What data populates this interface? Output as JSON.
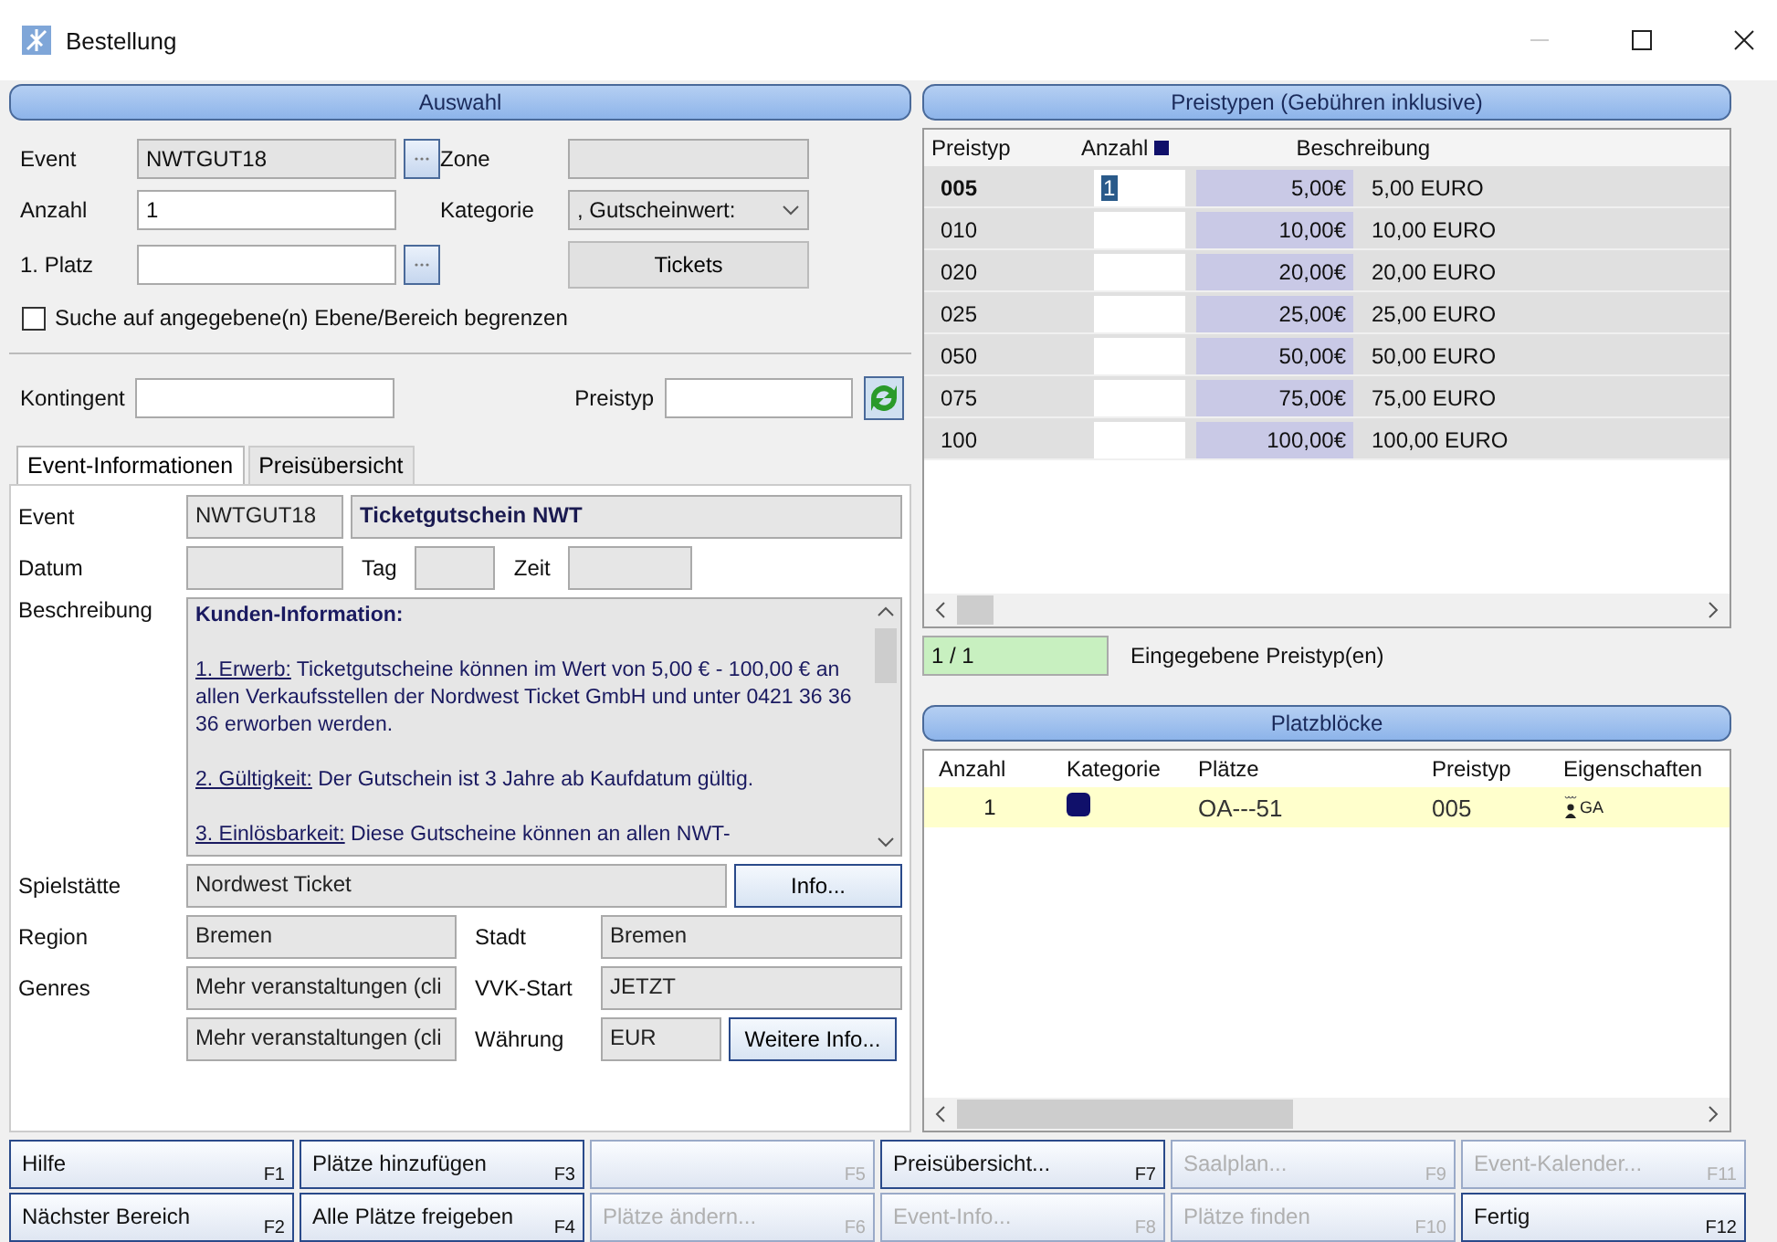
{
  "window": {
    "title": "Bestellung"
  },
  "auswahl": {
    "title": "Auswahl",
    "event": {
      "label": "Event",
      "value": "NWTGUT18"
    },
    "anzahl": {
      "label": "Anzahl",
      "value": "1"
    },
    "platz": {
      "label": "1. Platz"
    },
    "zone": {
      "label": "Zone"
    },
    "kategorie": {
      "label": "Kategorie",
      "value": ", Gutscheinwert:"
    },
    "tickets_button": "Tickets",
    "limit_search": {
      "label": "Suche auf angegebene(n) Ebene/Bereich begrenzen",
      "checked": false
    },
    "kontingent": {
      "label": "Kontingent"
    },
    "preistyp": {
      "label": "Preistyp"
    }
  },
  "tabs": [
    {
      "label": "Event-Informationen",
      "selected": true
    },
    {
      "label": "Preisübersicht",
      "selected": false
    }
  ],
  "event_info": {
    "event_label": "Event",
    "event_code": "NWTGUT18",
    "event_name": "Ticketgutschein NWT",
    "datum_label": "Datum",
    "tag_label": "Tag",
    "zeit_label": "Zeit",
    "beschreibung_label": "Beschreibung",
    "beschreibung_heading": "Kunden-Information:",
    "beschreibung": [
      {
        "lead": "1. Erwerb:",
        "text": " Ticketgutscheine können im Wert von 5,00 € - 100,00 € an allen Verkaufsstellen der Nordwest Ticket GmbH und unter 0421 36 36 36 erworben werden."
      },
      {
        "lead": "2. Gültigkeit:",
        "text": " Der Gutschein ist 3 Jahre ab Kaufdatum gültig."
      },
      {
        "lead": "3. Einlösbarkeit:",
        "text": " Diese Gutscheine können an allen NWT-"
      }
    ],
    "spielstaette_label": "Spielstätte",
    "spielstaette": "Nordwest Ticket",
    "info_button": "Info...",
    "region_label": "Region",
    "region": "Bremen",
    "stadt_label": "Stadt",
    "stadt": "Bremen",
    "genres_label": "Genres",
    "genre_1": "Mehr veranstaltungen (cli",
    "vwk_label": "VVK-Start",
    "vwk": "JETZT",
    "genre_2": "Mehr veranstaltungen (cli",
    "waehrung_label": "Währung",
    "waehrung": "EUR",
    "more_button": "Weitere Info..."
  },
  "preistypen": {
    "title": "Preistypen (Gebühren inklusive)",
    "columns": [
      "Preistyp",
      "Anzahl",
      "Beschreibung"
    ],
    "rows": [
      {
        "code": "005",
        "anzahl": "1",
        "price": "5,00€",
        "description": "5,00 EURO",
        "selected": true
      },
      {
        "code": "010",
        "price": "10,00€",
        "description": "10,00 EURO",
        "selected": false
      },
      {
        "code": "020",
        "price": "20,00€",
        "description": "20,00 EURO",
        "selected": false
      },
      {
        "code": "025",
        "price": "25,00€",
        "description": "25,00 EURO",
        "selected": false
      },
      {
        "code": "050",
        "price": "50,00€",
        "description": "50,00 EURO",
        "selected": false
      },
      {
        "code": "075",
        "price": "75,00€",
        "description": "75,00 EURO",
        "selected": false
      },
      {
        "code": "100",
        "price": "100,00€",
        "description": "100,00 EURO",
        "selected": false
      }
    ],
    "count": "1 / 1",
    "count_label": "Eingegebene Preistyp(en)"
  },
  "platzbloecke": {
    "title": "Platzblöcke",
    "columns": [
      "Anzahl",
      "Kategorie",
      "Plätze",
      "Preistyp",
      "Eigenschaften"
    ],
    "rows": [
      {
        "anzahl": "1",
        "color": "#10106a",
        "plaetze": "OA---51",
        "preistyp": "005",
        "eigenschaft": "GA",
        "selected": true
      }
    ]
  },
  "buttons": [
    [
      {
        "label": "Hilfe",
        "key": "F1",
        "disabled": false
      },
      {
        "label": "Plätze hinzufügen",
        "key": "F3",
        "disabled": false
      },
      {
        "key": "F5",
        "disabled": true
      },
      {
        "label": "Preisübersicht...",
        "key": "F7",
        "disabled": false
      },
      {
        "label": "Saalplan...",
        "key": "F9",
        "disabled": true
      },
      {
        "label": "Event-Kalender...",
        "key": "F11",
        "disabled": true
      }
    ],
    [
      {
        "label": "Nächster Bereich",
        "key": "F2",
        "disabled": false
      },
      {
        "label": "Alle Plätze freigeben",
        "key": "F4",
        "disabled": false
      },
      {
        "label": "Plätze ändern...",
        "key": "F6",
        "disabled": true
      },
      {
        "label": "Event-Info...",
        "key": "F8",
        "disabled": true
      },
      {
        "label": "Plätze finden",
        "key": "F10",
        "disabled": true
      },
      {
        "label": "Fertig",
        "key": "F12",
        "disabled": false
      }
    ]
  ]
}
